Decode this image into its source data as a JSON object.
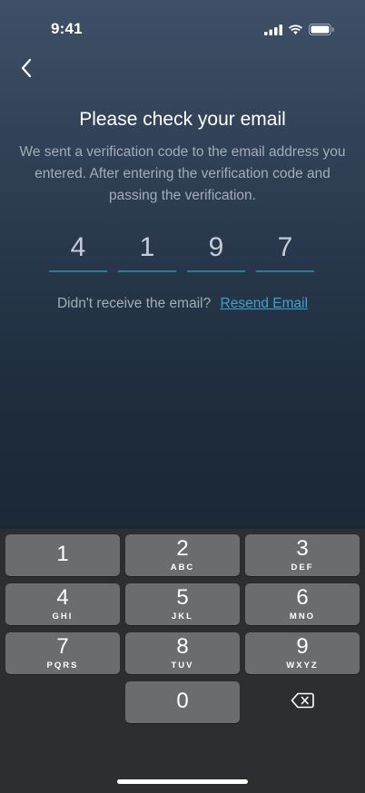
{
  "status_bar": {
    "time": "9:41"
  },
  "header": {
    "title": "Please check your email",
    "description": "We sent a verification code to the email address you entered. After entering the verification code and passing the verification."
  },
  "code": {
    "digits": [
      "4",
      "1",
      "9",
      "7"
    ]
  },
  "resend": {
    "prompt": "Didn't receive the email?",
    "link": "Resend Email"
  },
  "keypad": {
    "keys": [
      {
        "num": "1",
        "letters": ""
      },
      {
        "num": "2",
        "letters": "ABC"
      },
      {
        "num": "3",
        "letters": "DEF"
      },
      {
        "num": "4",
        "letters": "GHI"
      },
      {
        "num": "5",
        "letters": "JKL"
      },
      {
        "num": "6",
        "letters": "MNO"
      },
      {
        "num": "7",
        "letters": "PQRS"
      },
      {
        "num": "8",
        "letters": "TUV"
      },
      {
        "num": "9",
        "letters": "WXYZ"
      },
      {
        "num": "0",
        "letters": ""
      }
    ]
  },
  "colors": {
    "accent": "#3fa3c6",
    "underline": "#2f7a94",
    "key": "#6a6c70",
    "keyboard": "#2c2e32"
  },
  "icons": {
    "back": "chevron-left-icon",
    "signal": "cellular-signal-icon",
    "wifi": "wifi-icon",
    "battery": "battery-icon",
    "backspace": "backspace-icon"
  }
}
